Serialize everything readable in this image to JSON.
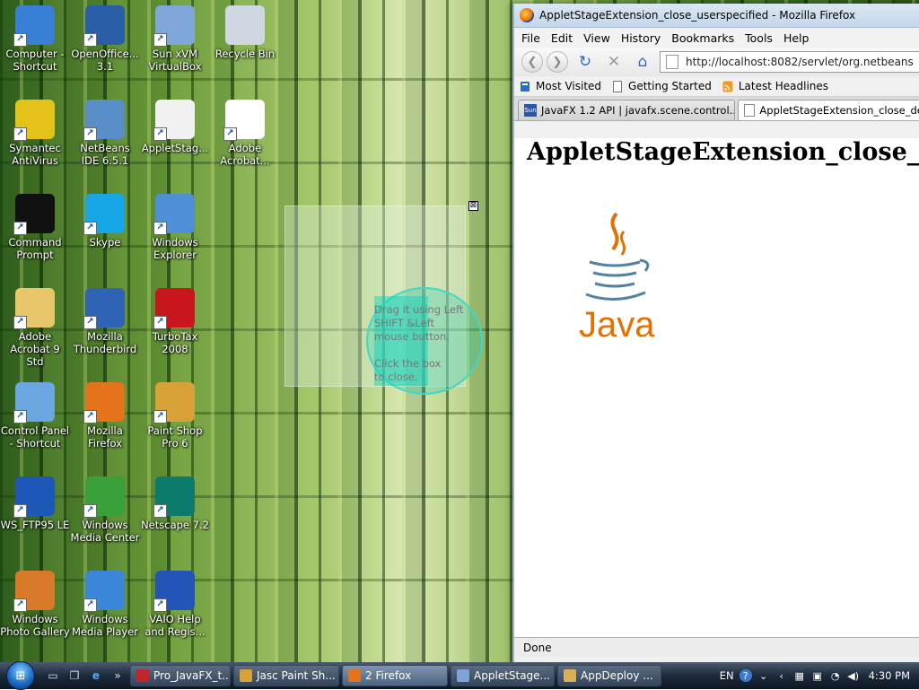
{
  "desktop": {
    "icons": [
      {
        "label": "Computer - Shortcut",
        "glyph": "computer-icon",
        "color": "#3a7fd6"
      },
      {
        "label": "OpenOffice... 3.1",
        "glyph": "openoffice-icon",
        "color": "#2b5ea8"
      },
      {
        "label": "Sun xVM VirtualBox",
        "glyph": "virtualbox-icon",
        "color": "#7fa7d9"
      },
      {
        "label": "Recycle Bin",
        "glyph": "recycle-bin-icon",
        "color": "#cfd8e2"
      },
      {
        "label": "Symantec AntiVirus",
        "glyph": "symantec-icon",
        "color": "#e4c21a"
      },
      {
        "label": "NetBeans IDE 6.5.1",
        "glyph": "netbeans-icon",
        "color": "#5a8ec9"
      },
      {
        "label": "AppletStag...",
        "glyph": "java-icon",
        "color": "#f1f1f1"
      },
      {
        "label": "Adobe Acrobat...",
        "glyph": "acrobat-icon",
        "color": "#ffffff"
      },
      {
        "label": "Command Prompt",
        "glyph": "command-prompt-icon",
        "color": "#111111"
      },
      {
        "label": "Skype",
        "glyph": "skype-icon",
        "color": "#16a6e8"
      },
      {
        "label": "Windows Explorer",
        "glyph": "explorer-icon",
        "color": "#4f8fd8"
      },
      {
        "label": "Adobe Acrobat 9 Std",
        "glyph": "folder-icon",
        "color": "#e8c66a"
      },
      {
        "label": "Mozilla Thunderbird",
        "glyph": "thunderbird-icon",
        "color": "#2f63b5"
      },
      {
        "label": "TurboTax 2008",
        "glyph": "turbotax-icon",
        "color": "#c8161c"
      },
      {
        "label": "Control Panel - Shortcut",
        "glyph": "control-panel-icon",
        "color": "#6aa6e0"
      },
      {
        "label": "Mozilla Firefox",
        "glyph": "firefox-icon",
        "color": "#e4731b"
      },
      {
        "label": "Paint Shop Pro 6",
        "glyph": "paint-shop-icon",
        "color": "#d9a238"
      },
      {
        "label": "WS_FTP95 LE",
        "glyph": "ftp-icon",
        "color": "#1d58b8"
      },
      {
        "label": "Windows Media Center",
        "glyph": "media-center-icon",
        "color": "#3aa13a"
      },
      {
        "label": "Netscape 7.2",
        "glyph": "netscape-icon",
        "color": "#0c7b6b"
      },
      {
        "label": "Windows Photo Gallery",
        "glyph": "photo-gallery-icon",
        "color": "#d97a2a"
      },
      {
        "label": "Windows Media Player",
        "glyph": "media-player-icon",
        "color": "#3a86d8"
      },
      {
        "label": "VAIO Help and Regis...",
        "glyph": "help-icon",
        "color": "#2454b8"
      }
    ]
  },
  "fx_stage": {
    "close_glyph": "⊠",
    "instructions": "Drag it using Left\nSHIFT &Left\nmouse button.\n\nClick the box\nto close."
  },
  "firefox": {
    "title": "AppletStageExtension_close_userspecified - Mozilla Firefox",
    "menu": [
      "File",
      "Edit",
      "View",
      "History",
      "Bookmarks",
      "Tools",
      "Help"
    ],
    "url": "http://localhost:8082/servlet/org.netbeans",
    "bookmarks": [
      "Most Visited",
      "Getting Started",
      "Latest Headlines"
    ],
    "tabs": [
      {
        "label": "JavaFX 1.2 API | javafx.scene.control...",
        "icon_text": "Sun"
      },
      {
        "label": "AppletStageExtension_close_def"
      }
    ],
    "page_heading": "AppletStageExtension_close_use",
    "logo_text": "Java",
    "status": "Done"
  },
  "taskbar": {
    "buttons": [
      {
        "label": "Pro_JavaFX_t...",
        "icon": "pdf-icon",
        "color": "#c0262b"
      },
      {
        "label": "Jasc Paint Sh...",
        "icon": "paint-shop-icon",
        "color": "#d9a238"
      },
      {
        "label": "2 Firefox",
        "icon": "firefox-icon",
        "color": "#e4731b",
        "active": true
      },
      {
        "label": "AppletStage...",
        "icon": "java-icon",
        "color": "#7da3d8"
      },
      {
        "label": "AppDeploy ...",
        "icon": "app-icon",
        "color": "#d8b05a"
      }
    ],
    "tray": {
      "language": "EN",
      "time": "4:30 PM"
    }
  },
  "colors": {
    "java_orange": "#e76f00",
    "java_blue": "#5382a1",
    "fx_teal": "#3fd8c8"
  }
}
